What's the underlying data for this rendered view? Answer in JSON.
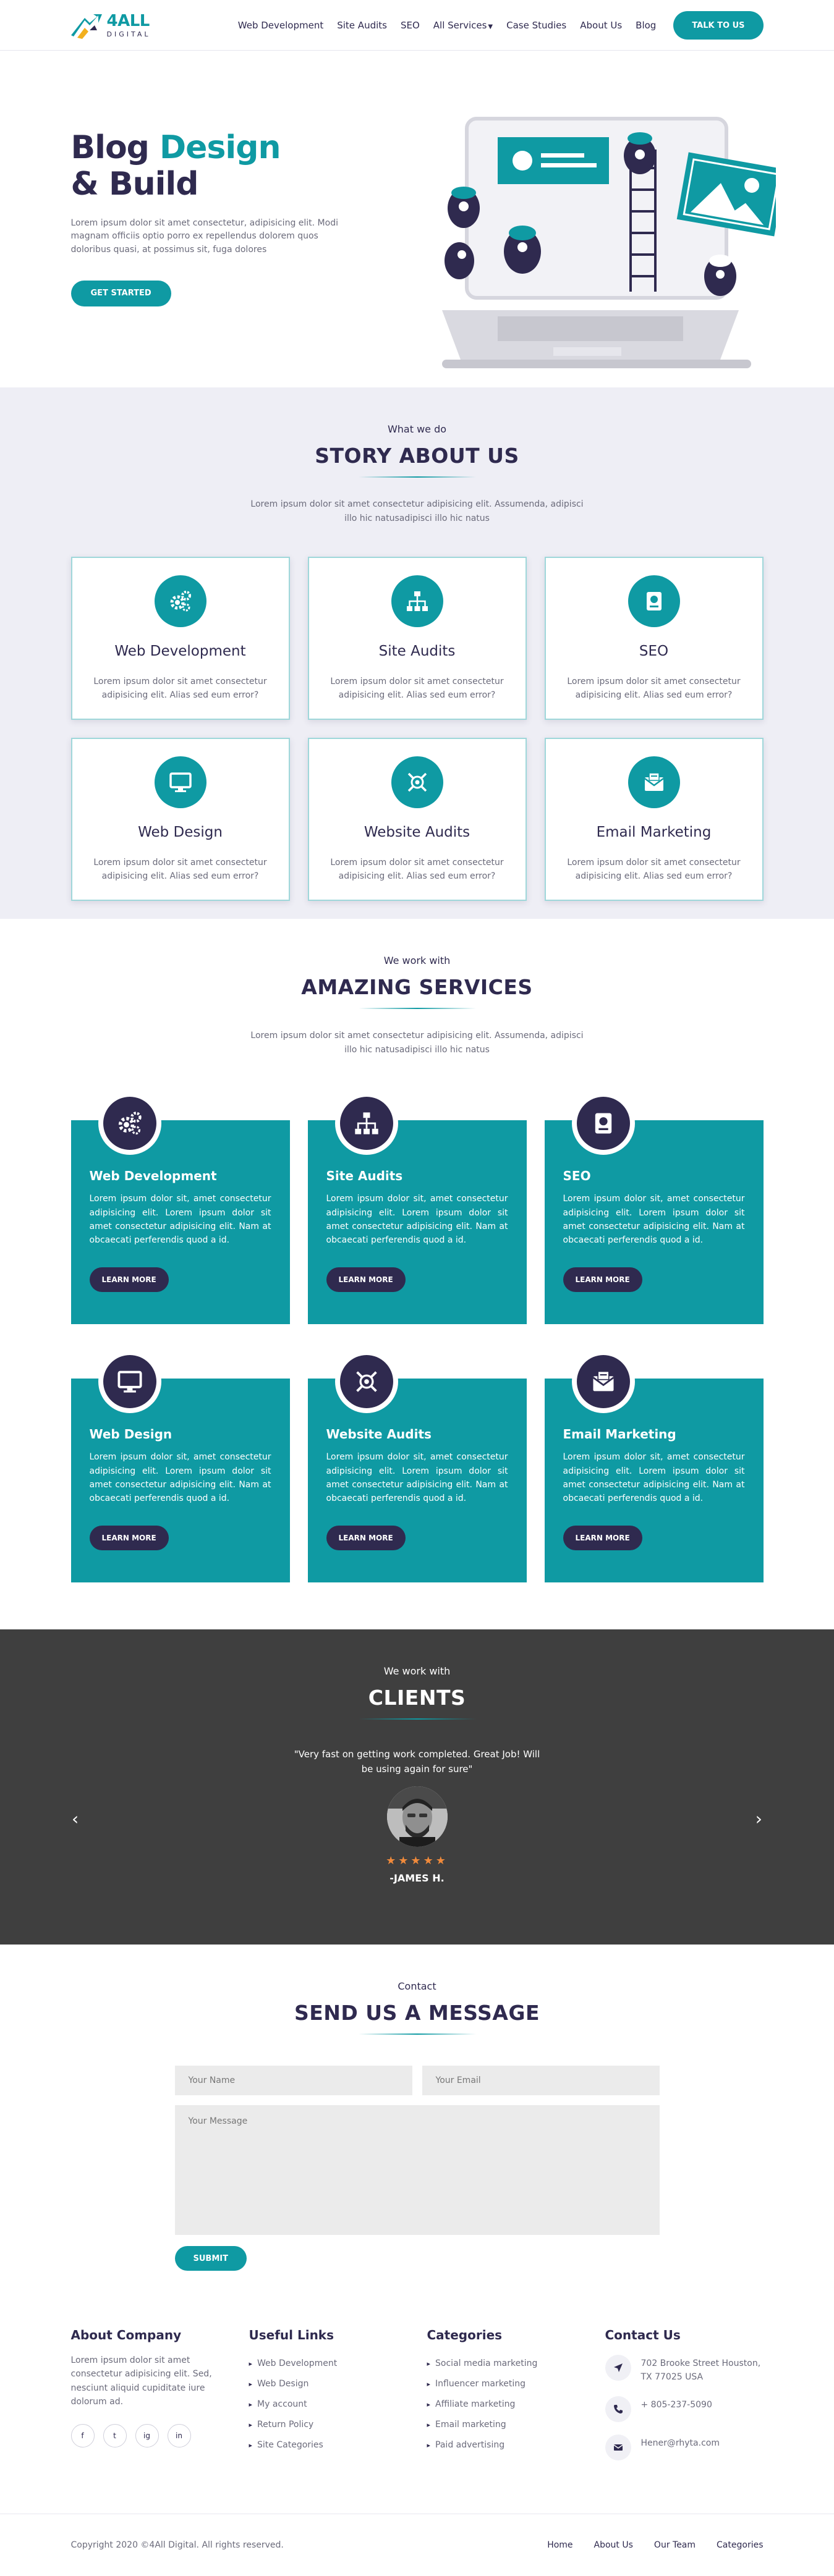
{
  "header": {
    "logo_name": "4ALL",
    "logo_sub": "DIGITAL",
    "nav": [
      "Web Development",
      "Site Audits",
      "SEO",
      "All Services",
      "Case Studies",
      "About Us",
      "Blog"
    ],
    "cta": "TALK TO US"
  },
  "hero": {
    "title_1": "Blog",
    "title_accent": "Design",
    "title_2": "& Build",
    "description": "Lorem ipsum dolor sit amet consectetur, adipisicing elit. Modi magnam officiis optio porro ex repellendus dolorem quos doloribus quasi, at possimus sit, fuga dolores",
    "button": "GET STARTED"
  },
  "story": {
    "kicker": "What we do",
    "title": "STORY ABOUT US",
    "description": "Lorem ipsum dolor sit amet consectetur adipisicing elit. Assumenda, adipisci illo hic natusadipisci illo hic natus",
    "cards": [
      {
        "icon": "gears-icon",
        "title": "Web Development",
        "text": "Lorem ipsum dolor sit amet consectetur adipisicing elit. Alias sed eum error?"
      },
      {
        "icon": "sitemap-icon",
        "title": "Site Audits",
        "text": "Lorem ipsum dolor sit amet consectetur adipisicing elit. Alias sed eum error?"
      },
      {
        "icon": "book-icon",
        "title": "SEO",
        "text": "Lorem ipsum dolor sit amet consectetur adipisicing elit. Alias sed eum error?"
      },
      {
        "icon": "monitor-icon",
        "title": "Web Design",
        "text": "Lorem ipsum dolor sit amet consectetur adipisicing elit. Alias sed eum error?"
      },
      {
        "icon": "target-icon",
        "title": "Website Audits",
        "text": "Lorem ipsum dolor sit amet consectetur adipisicing elit. Alias sed eum error?"
      },
      {
        "icon": "envelope-icon",
        "title": "Email Marketing",
        "text": "Lorem ipsum dolor sit amet consectetur adipisicing elit. Alias sed eum error?"
      }
    ]
  },
  "services": {
    "kicker": "We work with",
    "title": "AMAZING SERVICES",
    "description": "Lorem ipsum dolor sit amet consectetur adipisicing elit. Assumenda, adipisci illo hic natusadipisci illo hic natus",
    "button": "LEARN MORE",
    "cards": [
      {
        "icon": "gears-icon",
        "title": "Web Development",
        "text": "Lorem ipsum dolor sit, amet consectetur adipisicing elit. Lorem ipsum dolor sit amet consectetur adipisicing elit. Nam at obcaecati perferendis quod a id."
      },
      {
        "icon": "sitemap-icon",
        "title": "Site Audits",
        "text": "Lorem ipsum dolor sit, amet consectetur adipisicing elit. Lorem ipsum dolor sit amet consectetur adipisicing elit. Nam at obcaecati perferendis quod a id."
      },
      {
        "icon": "book-icon",
        "title": "SEO",
        "text": "Lorem ipsum dolor sit, amet consectetur adipisicing elit. Lorem ipsum dolor sit amet consectetur adipisicing elit. Nam at obcaecati perferendis quod a id."
      },
      {
        "icon": "monitor-icon",
        "title": "Web Design",
        "text": "Lorem ipsum dolor sit, amet consectetur adipisicing elit. Lorem ipsum dolor sit amet consectetur adipisicing elit. Nam at obcaecati perferendis quod a id."
      },
      {
        "icon": "target-icon",
        "title": "Website Audits",
        "text": "Lorem ipsum dolor sit, amet consectetur adipisicing elit. Lorem ipsum dolor sit amet consectetur adipisicing elit. Nam at obcaecati perferendis quod a id."
      },
      {
        "icon": "envelope-icon",
        "title": "Email Marketing",
        "text": "Lorem ipsum dolor sit, amet consectetur adipisicing elit. Lorem ipsum dolor sit amet consectetur adipisicing elit. Nam at obcaecati perferendis quod a id."
      }
    ]
  },
  "clients": {
    "kicker": "We work with",
    "title": "CLIENTS",
    "quote": "\"Very fast on getting work completed. Great Job! Will be using again for sure\"",
    "rating": 5,
    "stars": "★★★★★",
    "name": "-JAMES H.",
    "prev": "‹",
    "next": "›"
  },
  "contact": {
    "kicker": "Contact",
    "title": "SEND US A MESSAGE",
    "name_placeholder": "Your Name",
    "email_placeholder": "Your Email",
    "message_placeholder": "Your Message",
    "submit": "SUBMIT"
  },
  "footer": {
    "about_title": "About Company",
    "about_text": "Lorem ipsum dolor sit amet consectetur adipisicing elit. Sed, nesciunt aliquid cupiditate iure dolorum ad.",
    "socials": [
      "f",
      "t",
      "ig",
      "in"
    ],
    "links_title": "Useful Links",
    "links": [
      "Web Development",
      "Web Design",
      "My account",
      "Return Policy",
      "Site Categories"
    ],
    "categories_title": "Categories",
    "categories": [
      "Social media marketing",
      "Influencer marketing",
      "Affiliate marketing",
      "Email marketing",
      "Paid advertising"
    ],
    "contact_title": "Contact Us",
    "address": "702 Brooke Street Houston, TX 77025 USA",
    "phone": "+ 805-237-5090",
    "email": "Hener@rhyta.com"
  },
  "bottom": {
    "copyright": "Copyright 2020 ©4All Digital. All rights reserved.",
    "nav": [
      "Home",
      "About Us",
      "Our Team",
      "Categories"
    ]
  },
  "colors": {
    "accent": "#0f9aa3",
    "dark": "#2f2a4f",
    "section_bg": "#eeeef5",
    "clients_bg": "#3f3f3f",
    "star": "#f08a3b"
  }
}
